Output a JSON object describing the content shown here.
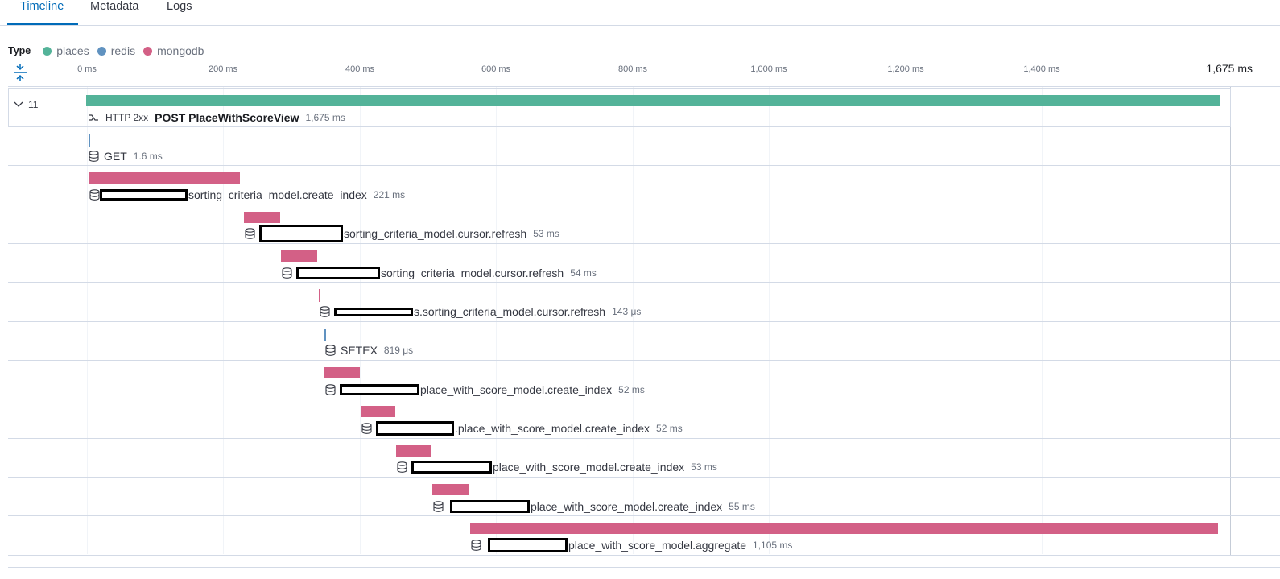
{
  "tabs": [
    {
      "label": "Timeline",
      "active": true
    },
    {
      "label": "Metadata",
      "active": false
    },
    {
      "label": "Logs",
      "active": false
    }
  ],
  "legend": {
    "title": "Type",
    "items": [
      {
        "label": "places",
        "color": "#54b399"
      },
      {
        "label": "redis",
        "color": "#6092c0"
      },
      {
        "label": "mongodb",
        "color": "#d36086"
      }
    ]
  },
  "axis": {
    "ticks": [
      "0 ms",
      "200 ms",
      "400 ms",
      "600 ms",
      "800 ms",
      "1,000 ms",
      "1,200 ms",
      "1,400 ms"
    ],
    "total": "1,675 ms"
  },
  "root": {
    "child_count": "11",
    "status": "HTTP 2xx",
    "name": "POST PlaceWithScoreView",
    "duration": "1,675 ms",
    "color": "#54b399"
  },
  "spans": [
    {
      "name": "GET",
      "duration": "1.6 ms",
      "type": "redis"
    },
    {
      "name": "sorting_criteria_model.create_index",
      "duration": "221 ms",
      "type": "mongodb"
    },
    {
      "name": "sorting_criteria_model.cursor.refresh",
      "duration": "53 ms",
      "type": "mongodb"
    },
    {
      "name": "sorting_criteria_model.cursor.refresh",
      "duration": "54 ms",
      "type": "mongodb"
    },
    {
      "name": "s.sorting_criteria_model.cursor.refresh",
      "duration": "143 μs",
      "type": "mongodb"
    },
    {
      "name": "SETEX",
      "duration": "819 μs",
      "type": "redis"
    },
    {
      "name": "place_with_score_model.create_index",
      "duration": "52 ms",
      "type": "mongodb"
    },
    {
      "name": ".place_with_score_model.create_index",
      "duration": "52 ms",
      "type": "mongodb"
    },
    {
      "name": "place_with_score_model.create_index",
      "duration": "53 ms",
      "type": "mongodb"
    },
    {
      "name": "place_with_score_model.create_index",
      "duration": "55 ms",
      "type": "mongodb"
    },
    {
      "name": "place_with_score_model.aggregate",
      "duration": "1,105 ms",
      "type": "mongodb"
    }
  ]
}
